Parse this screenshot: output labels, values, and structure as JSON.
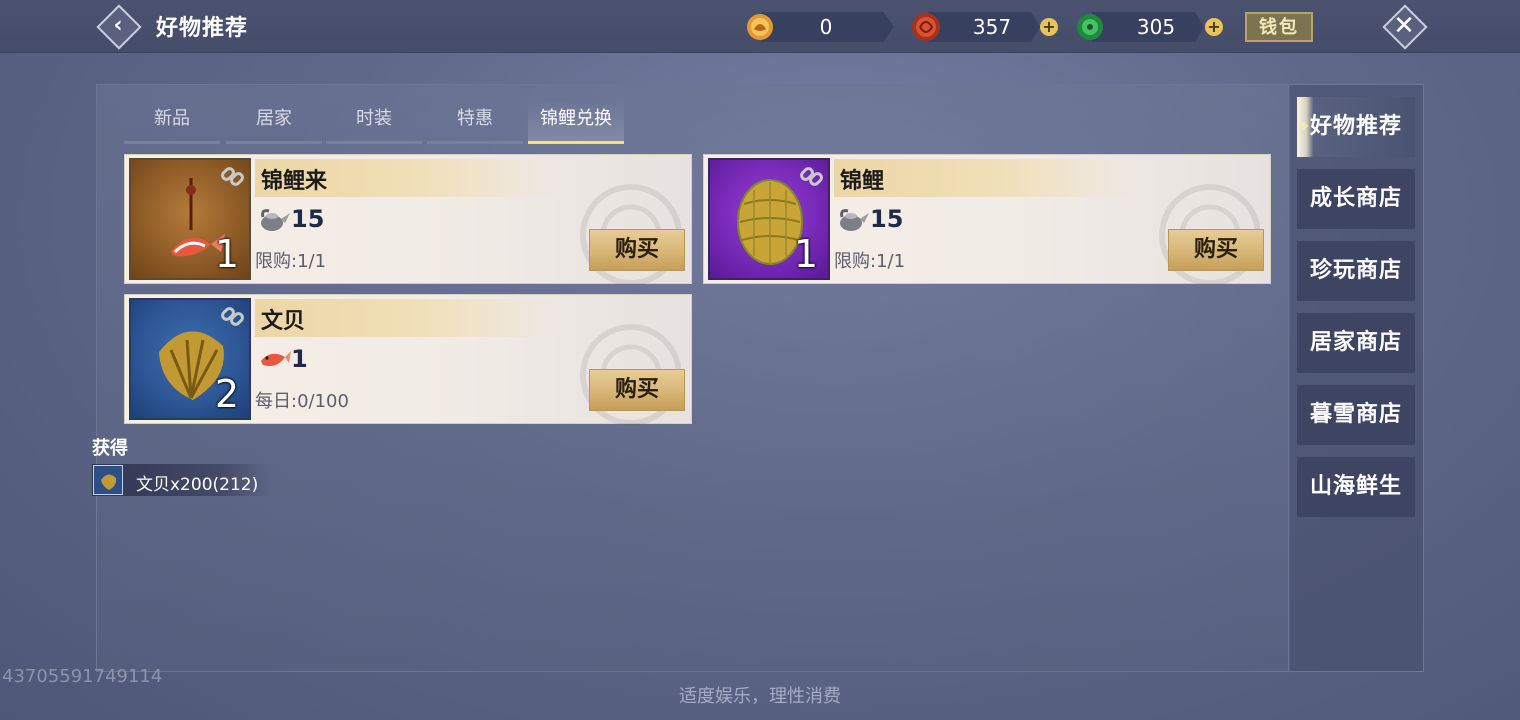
{
  "header": {
    "title": "好物推荐",
    "currencies": [
      {
        "name": "gold-ingot",
        "value": "0",
        "color": "#d98a2a"
      },
      {
        "name": "red-coin",
        "value": "357",
        "color": "#c8402a"
      },
      {
        "name": "jade-coin",
        "value": "305",
        "color": "#2fa84c"
      }
    ],
    "wallet_label": "钱包"
  },
  "tabs": [
    "新品",
    "居家",
    "时装",
    "特惠",
    "锦鲤兑换"
  ],
  "active_tab": "锦鲤兑换",
  "products": [
    {
      "name": "锦鲤来",
      "price": "15",
      "limit": "限购:1/1",
      "qty": "1",
      "buy_label": "购买",
      "price_icon": "silver-teapot-icon",
      "thumb_icon": "koi-pendant-icon"
    },
    {
      "name": "锦鲤",
      "price": "15",
      "limit": "限购:1/1",
      "qty": "1",
      "buy_label": "购买",
      "price_icon": "silver-teapot-icon",
      "thumb_icon": "golden-egg-icon"
    },
    {
      "name": "文贝",
      "price": "1",
      "limit": "每日:0/100",
      "qty": "2",
      "buy_label": "购买",
      "price_icon": "koi-fish-icon",
      "thumb_icon": "golden-shell-icon"
    }
  ],
  "obtained": {
    "title": "获得",
    "item_text": "文贝x200(212)"
  },
  "side_nav": [
    "好物推荐",
    "成长商店",
    "珍玩商店",
    "居家商店",
    "暮雪商店",
    "山海鲜生"
  ],
  "active_side_nav": "好物推荐",
  "footer": "适度娱乐，理性消费",
  "uid": "43705591749114"
}
